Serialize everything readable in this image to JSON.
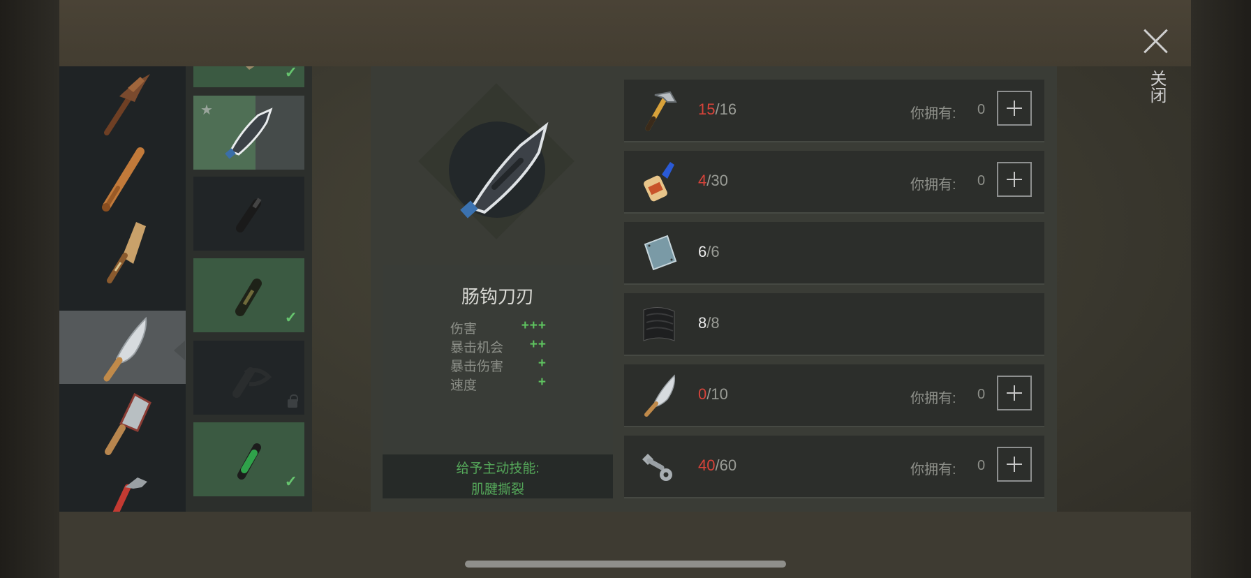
{
  "close_label": "关闭",
  "item": {
    "name": "肠钩刀刃",
    "stats": [
      {
        "label": "伤害",
        "value": "+++"
      },
      {
        "label": "暴击机会",
        "value": "++"
      },
      {
        "label": "暴击伤害",
        "value": "+"
      },
      {
        "label": "速度",
        "value": "+"
      }
    ],
    "skill_label": "给予主动技能:",
    "skill_name": "肌腱撕裂"
  },
  "categories": [
    {
      "icon": "pickaxe-icon"
    },
    {
      "icon": "baseball-bat-icon"
    },
    {
      "icon": "wooden-paddle-icon"
    },
    {
      "icon": "machete-icon",
      "selected": true
    },
    {
      "icon": "cleaver-icon"
    },
    {
      "icon": "pipe-wrench-icon"
    }
  ],
  "components": [
    {
      "icon": "blade-tip-icon",
      "owned": true
    },
    {
      "icon": "hook-blade-icon",
      "current": true,
      "favorite": true
    },
    {
      "icon": "black-handle-icon"
    },
    {
      "icon": "camo-handle-icon",
      "owned": true
    },
    {
      "icon": "guard-handle-icon",
      "locked": true
    },
    {
      "icon": "green-grip-icon",
      "owned": true
    }
  ],
  "materials": [
    {
      "icon": "hammer-icon",
      "have": "15",
      "need": "16",
      "own_label": "你拥有:",
      "own_value": "0",
      "buyable": true,
      "enough": false
    },
    {
      "icon": "glue-icon",
      "have": "4",
      "need": "30",
      "own_label": "你拥有:",
      "own_value": "0",
      "buyable": true,
      "enough": false
    },
    {
      "icon": "metal-plate-icon",
      "have": "6",
      "need": "6",
      "buyable": false,
      "enough": true
    },
    {
      "icon": "rubber-sheet-icon",
      "have": "8",
      "need": "8",
      "buyable": false,
      "enough": true
    },
    {
      "icon": "machete-icon",
      "have": "0",
      "need": "10",
      "own_label": "你拥有:",
      "own_value": "0",
      "buyable": true,
      "enough": false
    },
    {
      "icon": "bolts-icon",
      "have": "40",
      "need": "60",
      "own_label": "你拥有:",
      "own_value": "0",
      "buyable": true,
      "enough": false
    }
  ],
  "colors": {
    "shortage": "#d8433a",
    "bonus": "#5ec25f",
    "owned_card": "#3b5a42"
  }
}
